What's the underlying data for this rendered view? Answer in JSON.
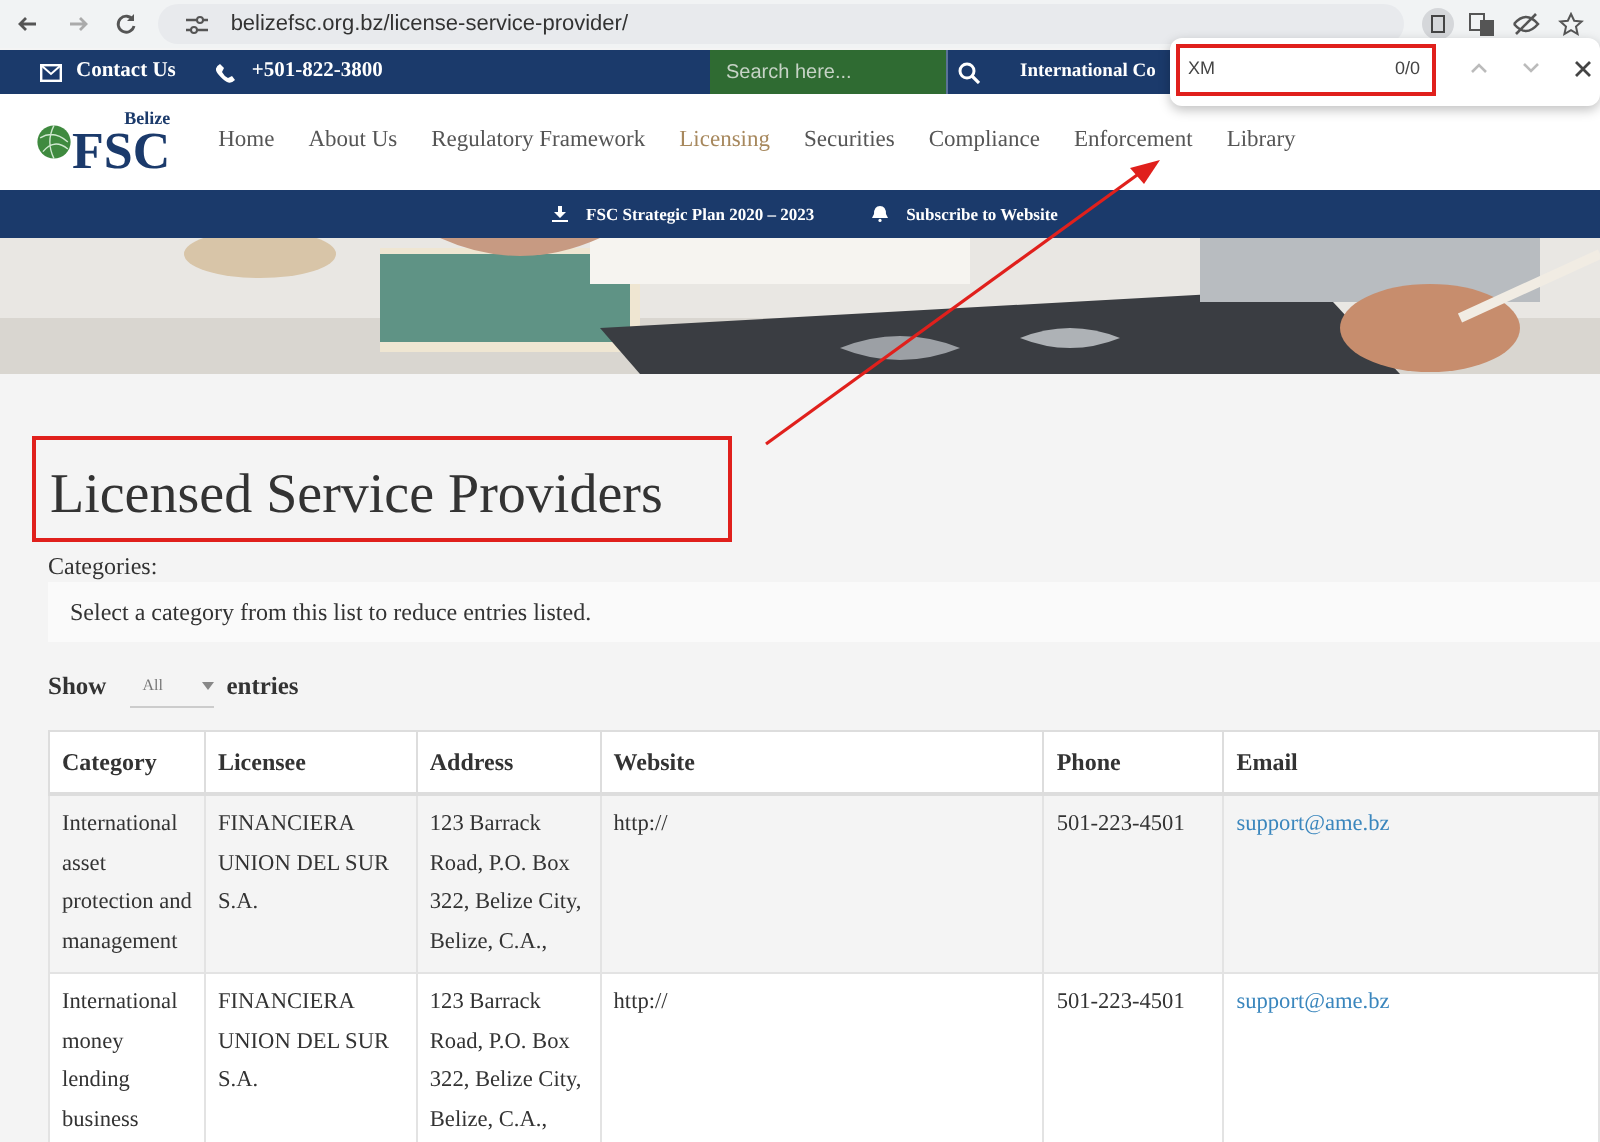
{
  "browser": {
    "url": "belizefsc.org.bz/license-service-provider/",
    "find": {
      "query": "XM",
      "count": "0/0"
    }
  },
  "topbar": {
    "contact": "Contact Us",
    "phone": "+501-822-3800",
    "search_placeholder": "Search here...",
    "link": "International Co"
  },
  "logo": {
    "small": "Belize",
    "big": "FSC"
  },
  "nav": [
    {
      "label": "Home",
      "selected": false
    },
    {
      "label": "About Us",
      "selected": false
    },
    {
      "label": "Regulatory Framework",
      "selected": false
    },
    {
      "label": "Licensing",
      "selected": true
    },
    {
      "label": "Securities",
      "selected": false
    },
    {
      "label": "Compliance",
      "selected": false
    },
    {
      "label": "Enforcement",
      "selected": false
    },
    {
      "label": "Library",
      "selected": false
    }
  ],
  "subbar": [
    {
      "kind": "download",
      "label": "FSC Strategic Plan 2020 – 2023"
    },
    {
      "kind": "bell",
      "label": "Subscribe to Website"
    }
  ],
  "page": {
    "title": "Licensed Service Providers",
    "categories_label": "Categories:",
    "category_select": "Select a category from this list to reduce entries listed.",
    "show": "Show",
    "entries_value": "All",
    "entries": "entries"
  },
  "table": {
    "columns": [
      "Category",
      "Licensee",
      "Address",
      "Website",
      "Phone",
      "Email"
    ],
    "rows": [
      {
        "category": "International asset protection and management",
        "licensee": "FINANCIERA UNION DEL SUR S.A.",
        "address": "123 Barrack Road, P.O. Box 322, Belize City, Belize, C.A.,",
        "website": "http://",
        "phone": "501-223-4501",
        "email": "support@ame.bz"
      },
      {
        "category": "International money lending business",
        "licensee": "FINANCIERA UNION DEL SUR S.A.",
        "address": "123 Barrack Road, P.O. Box 322, Belize City, Belize, C.A.,",
        "website": "http://",
        "phone": "501-223-4501",
        "email": "support@ame.bz"
      }
    ]
  }
}
